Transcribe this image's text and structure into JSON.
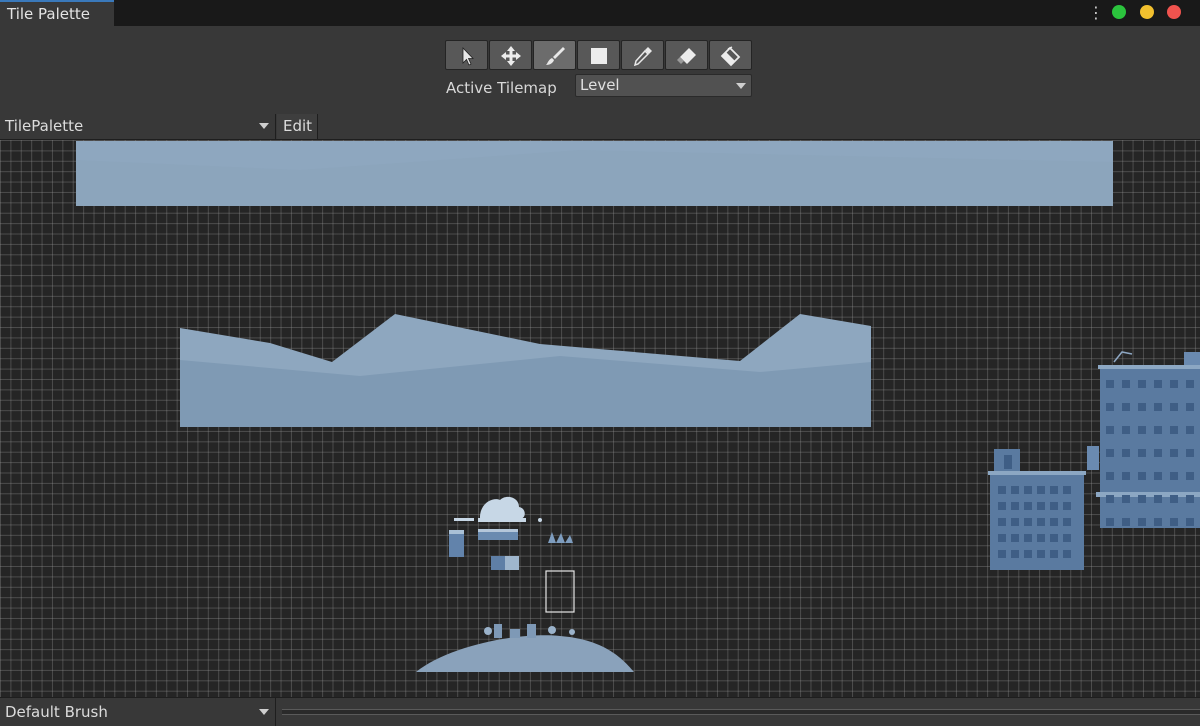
{
  "window": {
    "tab_title": "Tile Palette",
    "menu_icon": "kebab-menu-icon",
    "traffic_lights": {
      "green": "#2bc33d",
      "yellow": "#f2c02e",
      "red": "#f0534e"
    }
  },
  "toolbar": {
    "tools": [
      {
        "name": "select-tool",
        "icon": "arrow-cursor-icon",
        "selected": false
      },
      {
        "name": "move-tool",
        "icon": "move-arrows-icon",
        "selected": false
      },
      {
        "name": "paint-tool",
        "icon": "paintbrush-icon",
        "selected": true
      },
      {
        "name": "box-fill-tool",
        "icon": "box-fill-icon",
        "selected": false
      },
      {
        "name": "pick-tool",
        "icon": "eyedropper-icon",
        "selected": false
      },
      {
        "name": "erase-tool",
        "icon": "eraser-icon",
        "selected": false
      },
      {
        "name": "flood-fill-tool",
        "icon": "paint-bucket-icon",
        "selected": false
      }
    ],
    "active_tilemap_label": "Active Tilemap",
    "active_tilemap_value": "Level"
  },
  "palette_bar": {
    "palette_value": "TilePalette",
    "edit_label": "Edit"
  },
  "bottom_bar": {
    "brush_value": "Default Brush"
  },
  "colors": {
    "tile_light": "#8ea7bf",
    "tile_mid": "#7a95b2",
    "building": "#5a7aa0",
    "building_dark": "#3f5e85",
    "grid_bg": "#252525"
  }
}
